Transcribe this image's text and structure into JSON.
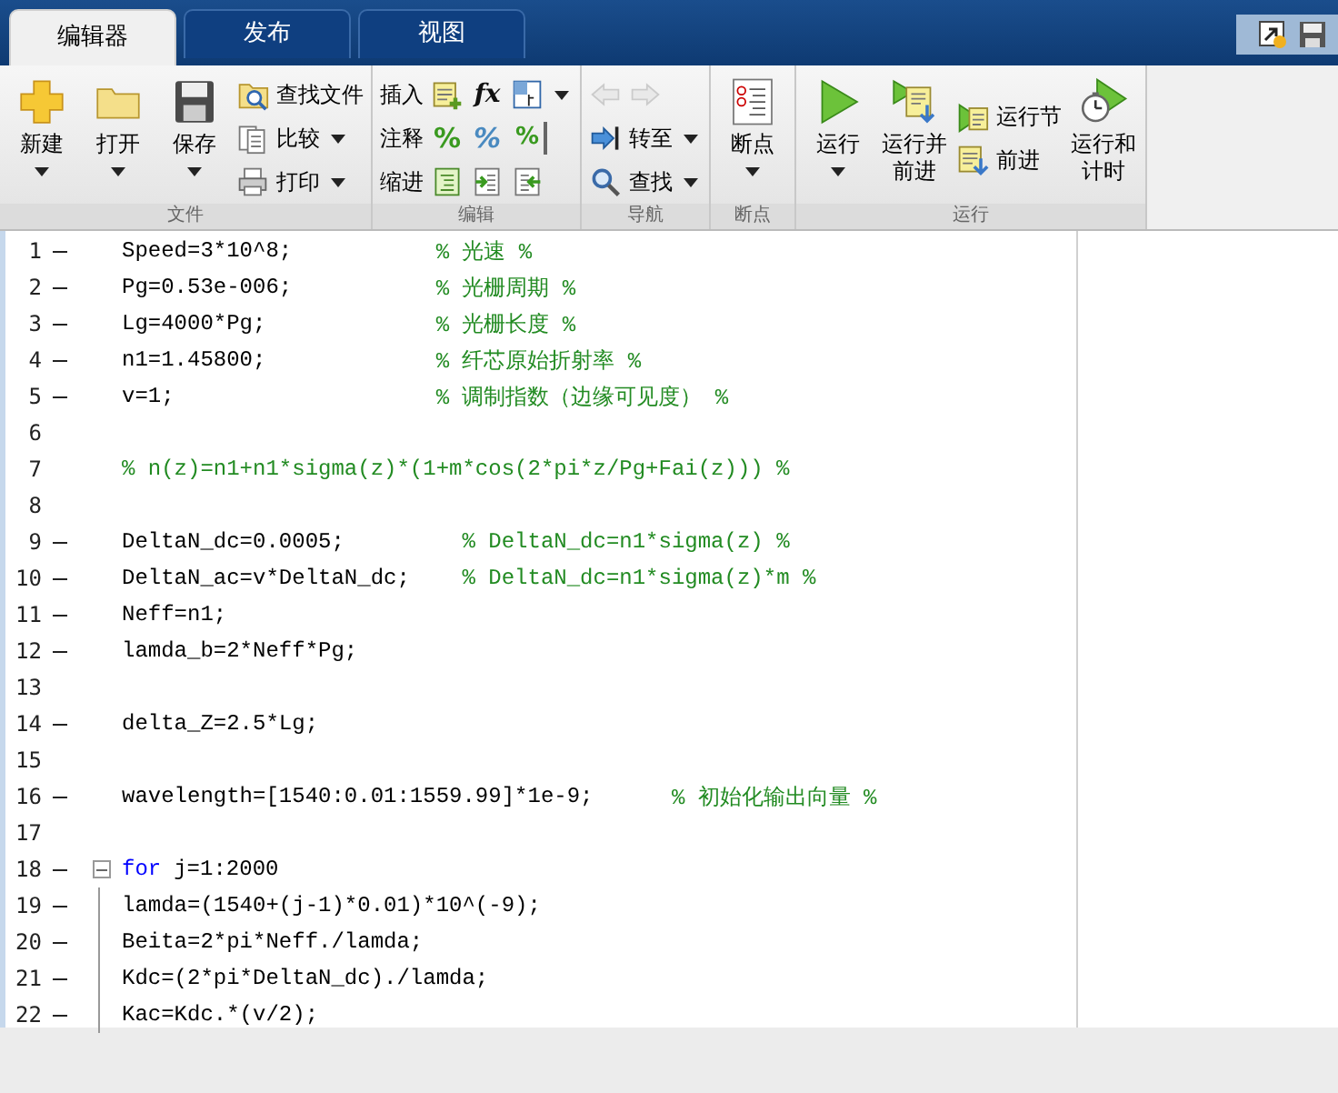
{
  "tabs": [
    {
      "label": "编辑器",
      "selected": true
    },
    {
      "label": "发布",
      "selected": false
    },
    {
      "label": "视图",
      "selected": false
    }
  ],
  "ribbon": {
    "sections": [
      {
        "title": "文件",
        "groups": [
          {
            "kind": "large",
            "label": "新建",
            "dropdown": true
          },
          {
            "kind": "large",
            "label": "打开",
            "dropdown": true
          },
          {
            "kind": "large",
            "label": "保存",
            "dropdown": true
          },
          {
            "kind": "stack",
            "rows": [
              {
                "label": "查找文件",
                "dropdown": false,
                "tools": [
                  {
                    "kind": "icon"
                  }
                ]
              },
              {
                "label": "比较",
                "dropdown": true,
                "tools": [
                  {
                    "kind": "icon"
                  }
                ]
              },
              {
                "label": "打印",
                "dropdown": true,
                "tools": [
                  {
                    "kind": "icon"
                  }
                ]
              }
            ]
          }
        ]
      },
      {
        "title": "编辑",
        "groups": [
          {
            "kind": "stack",
            "rows": [
              {
                "label": "插入",
                "dropdown": true,
                "tools": [
                  {
                    "kind": "icon"
                  },
                  {
                    "kind": "glyph",
                    "text": "fx"
                  },
                  {
                    "kind": "icon"
                  }
                ]
              },
              {
                "label": "注释",
                "dropdown": false,
                "tools": [
                  {
                    "kind": "glyph",
                    "text": "%"
                  },
                  {
                    "kind": "glyph",
                    "text": "%"
                  },
                  {
                    "kind": "glyph",
                    "text": "%"
                  }
                ]
              },
              {
                "label": "缩进",
                "dropdown": false,
                "tools": [
                  {
                    "kind": "icon"
                  },
                  {
                    "kind": "icon"
                  },
                  {
                    "kind": "icon"
                  }
                ]
              }
            ]
          }
        ]
      },
      {
        "title": "导航",
        "groups": [
          {
            "kind": "stack",
            "rows": [
              {
                "dropdown": false,
                "tools": [
                  {
                    "kind": "icon",
                    "disabled": true
                  },
                  {
                    "kind": "icon",
                    "disabled": true
                  }
                ]
              },
              {
                "label": "转至",
                "dropdown": true,
                "tools": [
                  {
                    "kind": "icon"
                  }
                ]
              },
              {
                "label": "查找",
                "dropdown": true,
                "tools": [
                  {
                    "kind": "icon"
                  }
                ]
              }
            ]
          }
        ]
      },
      {
        "title": "断点",
        "groups": [
          {
            "kind": "large",
            "label": "断点",
            "dropdown": true
          }
        ]
      },
      {
        "title": "运行",
        "groups": [
          {
            "kind": "large",
            "label": "运行",
            "dropdown": true
          },
          {
            "kind": "large",
            "label": "运行并前进",
            "dropdown": false
          },
          {
            "kind": "stack",
            "rows": [
              {
                "label": "运行节",
                "dropdown": false,
                "tools": [
                  {
                    "kind": "icon"
                  }
                ]
              },
              {
                "label": "前进",
                "dropdown": false,
                "tools": [
                  {
                    "kind": "icon"
                  }
                ]
              }
            ]
          },
          {
            "kind": "large",
            "label": "运行和计时",
            "dropdown": false
          }
        ]
      }
    ]
  },
  "editor": {
    "lines": [
      {
        "number": "1",
        "executable": true,
        "code": "Speed=3*10^8;           ",
        "comment": "% 光速 %"
      },
      {
        "number": "2",
        "executable": true,
        "code": "Pg=0.53e-006;           ",
        "comment": "% 光栅周期 %"
      },
      {
        "number": "3",
        "executable": true,
        "code": "Lg=4000*Pg;             ",
        "comment": "% 光栅长度 %"
      },
      {
        "number": "4",
        "executable": true,
        "code": "n1=1.45800;             ",
        "comment": "% 纤芯原始折射率 %"
      },
      {
        "number": "5",
        "executable": true,
        "code": "v=1;                    ",
        "comment": "% 调制指数（边缘可见度） %"
      },
      {
        "number": "6",
        "executable": false
      },
      {
        "number": "7",
        "executable": false,
        "comment": "% n(z)=n1+n1*sigma(z)*(1+m*cos(2*pi*z/Pg+Fai(z))) %"
      },
      {
        "number": "8",
        "executable": false
      },
      {
        "number": "9",
        "executable": true,
        "code": "DeltaN_dc=0.0005;         ",
        "comment": "% DeltaN_dc=n1*sigma(z) %"
      },
      {
        "number": "10",
        "executable": true,
        "code": "DeltaN_ac=v*DeltaN_dc;    ",
        "comment": "% DeltaN_dc=n1*sigma(z)*m %"
      },
      {
        "number": "11",
        "executable": true,
        "code": "Neff=n1;"
      },
      {
        "number": "12",
        "executable": true,
        "code": "lamda_b=2*Neff*Pg;"
      },
      {
        "number": "13",
        "executable": false
      },
      {
        "number": "14",
        "executable": true,
        "code": "delta_Z=2.5*Lg;"
      },
      {
        "number": "15",
        "executable": false
      },
      {
        "number": "16",
        "executable": true,
        "code": "wavelength=[1540:0.01:1559.99]*1e-9;      ",
        "comment": "% 初始化输出向量 %"
      },
      {
        "number": "17",
        "executable": false
      },
      {
        "number": "18",
        "executable": true,
        "kind": "fold_start",
        "keyword": "for",
        "code": "j=1:2000"
      },
      {
        "number": "19",
        "executable": true,
        "kind": "fold_body",
        "code": "lamda=(1540+(j-1)*0.01)*10^(-9);"
      },
      {
        "number": "20",
        "executable": true,
        "kind": "fold_body",
        "code": "Beita=2*pi*Neff./lamda;"
      },
      {
        "number": "21",
        "executable": true,
        "kind": "fold_body",
        "code": "Kdc=(2*pi*DeltaN_dc)./lamda;"
      },
      {
        "number": "22",
        "executable": true,
        "kind": "fold_body",
        "code": "Kac=Kdc.*(v/2);"
      }
    ]
  }
}
